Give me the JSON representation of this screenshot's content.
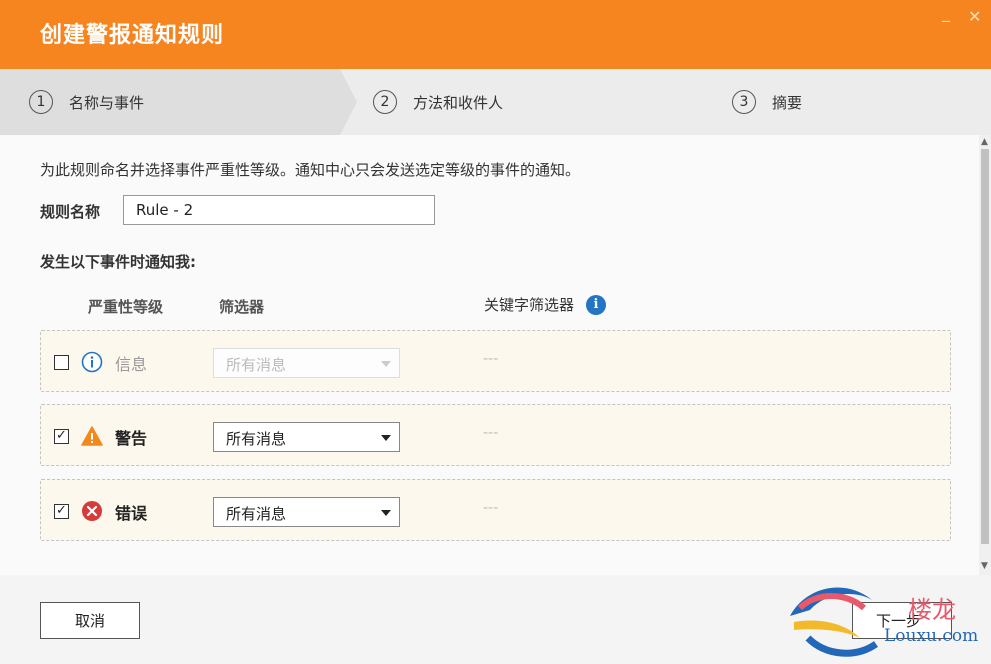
{
  "window": {
    "title": "创建警报通知规则",
    "minimize_icon": "minimize-icon",
    "close_icon": "close-icon",
    "min_glyph": "_",
    "close_glyph": "✕"
  },
  "steps": [
    {
      "number": "1",
      "label": "名称与事件",
      "active": true
    },
    {
      "number": "2",
      "label": "方法和收件人",
      "active": false
    },
    {
      "number": "3",
      "label": "摘要",
      "active": false
    }
  ],
  "content": {
    "description": "为此规则命名并选择事件严重性等级。通知中心只会发送选定等级的事件的通知。",
    "rule_name_label": "规则名称",
    "rule_name_value": "Rule - 2",
    "notify_label": "发生以下事件时通知我:",
    "columns": {
      "severity": "严重性等级",
      "filter": "筛选器",
      "keyword": "关键字筛选器",
      "keyword_info_icon": "info-icon",
      "keyword_info_glyph": "i"
    },
    "rows": [
      {
        "checked": false,
        "check_glyph": "",
        "icon": "info-icon",
        "label": "信息",
        "filter": "所有消息",
        "filter_enabled": false,
        "keyword": "---"
      },
      {
        "checked": true,
        "check_glyph": "✓",
        "icon": "warning-icon",
        "label": "警告",
        "filter": "所有消息",
        "filter_enabled": true,
        "keyword": "---"
      },
      {
        "checked": true,
        "check_glyph": "✓",
        "icon": "error-icon",
        "label": "错误",
        "filter": "所有消息",
        "filter_enabled": true,
        "keyword": "---"
      }
    ]
  },
  "footer": {
    "cancel_label": "取消",
    "next_label": "下一步"
  },
  "watermark": {
    "chinese": "楼龙",
    "url": "Louxu.com"
  },
  "colors": {
    "title_bar": "#f6841f",
    "info_blue": "#2474c6",
    "warning_orange": "#f08a1c",
    "error_red": "#d63a3a",
    "row_bg": "#fdf8ed"
  }
}
